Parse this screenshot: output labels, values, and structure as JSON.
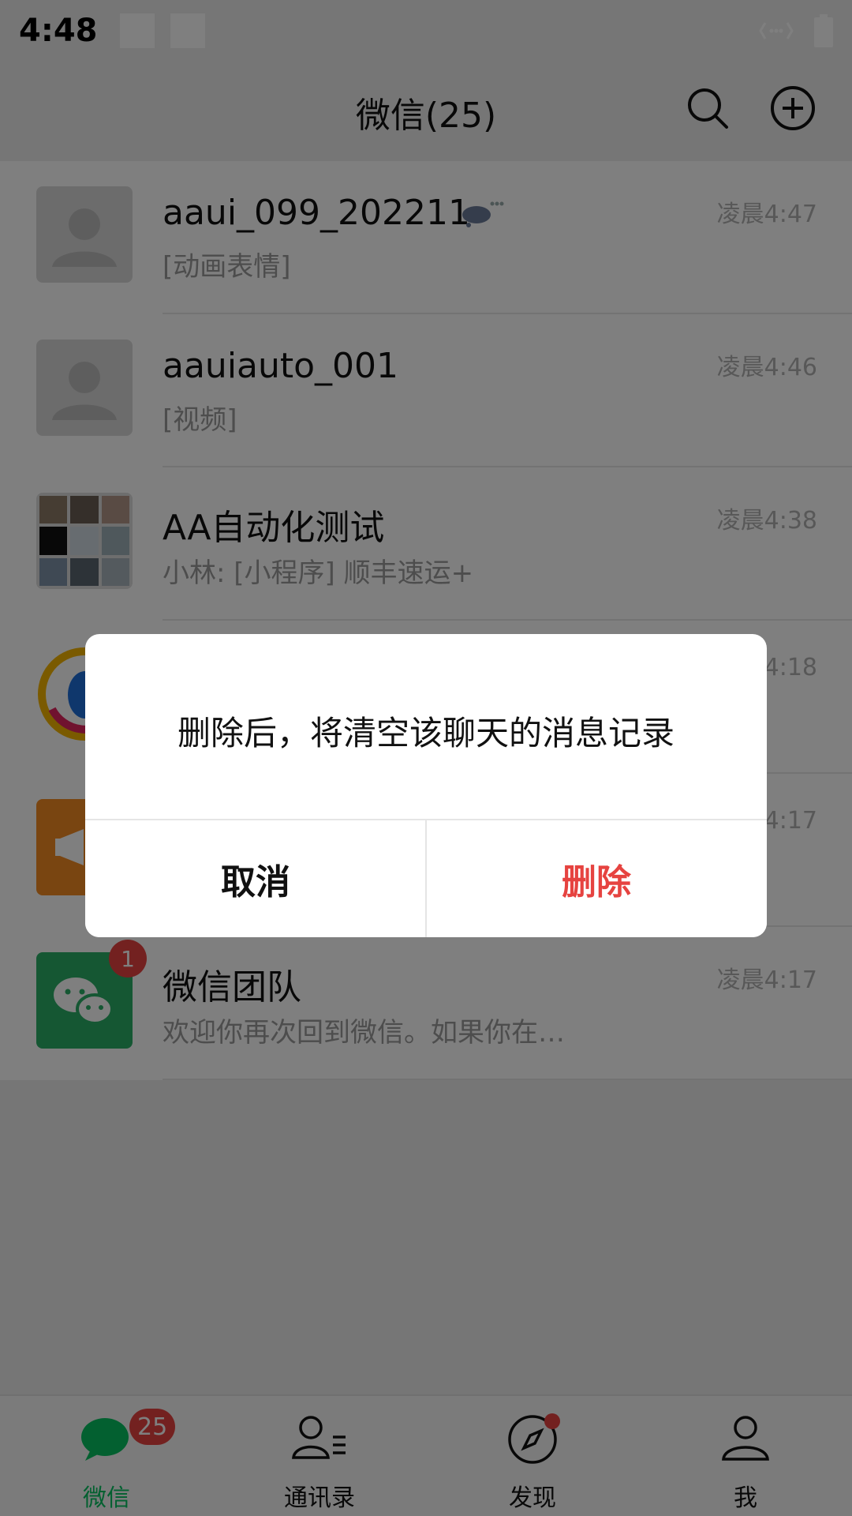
{
  "status_bar": {
    "time": "4:48"
  },
  "header": {
    "title": "微信(25)"
  },
  "chats": [
    {
      "name": "aaui_099_202211",
      "preview": "[动画表情]",
      "time": "凌晨4:47"
    },
    {
      "name": "aauiauto_001",
      "preview": "[视频]",
      "time": "凌晨4:46"
    },
    {
      "name": "AA自动化测试",
      "preview": "小林: [小程序] 顺丰速运+",
      "time": "凌晨4:38"
    },
    {
      "name": "",
      "preview": "",
      "time": "4:18"
    },
    {
      "name": "",
      "preview": "",
      "time": "4:17"
    },
    {
      "name": "微信团队",
      "preview": "欢迎你再次回到微信。如果你在…",
      "time": "凌晨4:17",
      "badge": "1"
    }
  ],
  "dialog": {
    "message": "删除后，将清空该聊天的消息记录",
    "cancel_label": "取消",
    "delete_label": "删除"
  },
  "nav": {
    "chats": {
      "label": "微信",
      "badge": "25"
    },
    "contacts": {
      "label": "通讯录"
    },
    "discover": {
      "label": "发现"
    },
    "me": {
      "label": "我"
    }
  },
  "colors": {
    "brand_green": "#07c160",
    "alert_red": "#e64340"
  }
}
